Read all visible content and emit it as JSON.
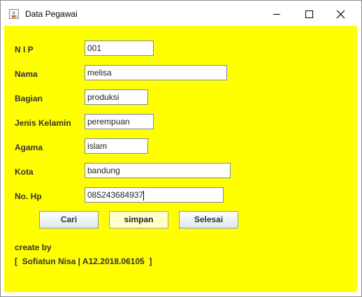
{
  "window": {
    "title": "Data Pegawai",
    "icon": "java-cup-icon",
    "controls": [
      "minimize-icon",
      "maximize-icon",
      "close-icon"
    ]
  },
  "form": {
    "fields": [
      {
        "label": "N I P",
        "value": "001"
      },
      {
        "label": "Nama",
        "value": "melisa"
      },
      {
        "label": "Bagian",
        "value": "produksi"
      },
      {
        "label": "Jenis Kelamin",
        "value": "perempuan"
      },
      {
        "label": "Agama",
        "value": "islam"
      },
      {
        "label": "Kota",
        "value": "bandung"
      },
      {
        "label": "No. Hp",
        "value": "085243684937"
      }
    ]
  },
  "buttons": {
    "cari": "Cari",
    "simpan": "simpan",
    "selesai": "Selesai"
  },
  "footer": {
    "line1": "create by",
    "line2": "[  Sofiatun Nisa | A12.2018.06105  ]"
  },
  "colors": {
    "background": "#ffff00",
    "focused_button": "#ffffcc"
  }
}
